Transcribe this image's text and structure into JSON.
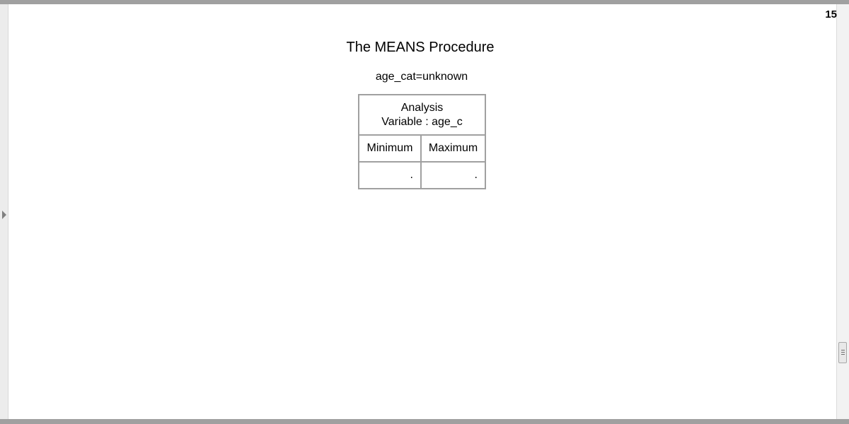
{
  "page": {
    "page_number": "15"
  },
  "report": {
    "title": "The MEANS Procedure",
    "byline": "age_cat=unknown"
  },
  "table": {
    "header_line1": "Analysis",
    "header_line2": "Variable : age_c",
    "columns": [
      "Minimum",
      "Maximum"
    ],
    "rows": [
      [
        ".",
        "."
      ]
    ]
  },
  "colors": {
    "border": "#a0a0a0",
    "background": "#ffffff"
  }
}
